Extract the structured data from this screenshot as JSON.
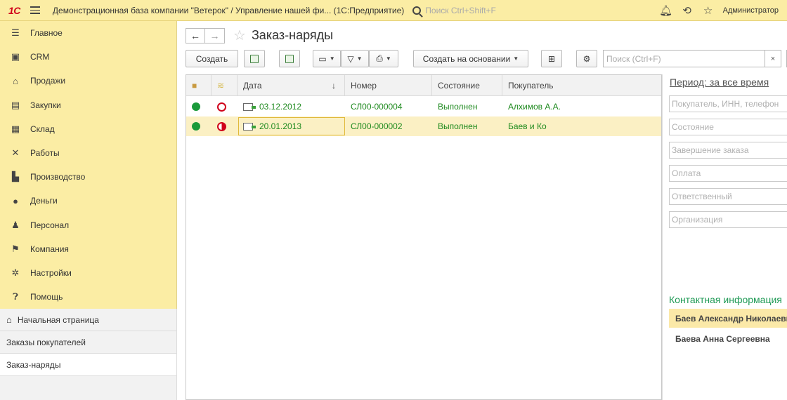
{
  "titlebar": {
    "logo": "1С",
    "title": "Демонстрационная база компании \"Ветерок\" / Управление нашей фи...   (1С:Предприятие)",
    "search_placeholder": "Поиск Ctrl+Shift+F",
    "user": "Администратор"
  },
  "sidebar": {
    "items": [
      {
        "label": "Главное",
        "icon": "menu-lines-icon"
      },
      {
        "label": "CRM",
        "icon": "contact-card-icon"
      },
      {
        "label": "Продажи",
        "icon": "shop-icon"
      },
      {
        "label": "Закупки",
        "icon": "cart-icon"
      },
      {
        "label": "Склад",
        "icon": "warehouse-icon"
      },
      {
        "label": "Работы",
        "icon": "tools-icon"
      },
      {
        "label": "Производство",
        "icon": "factory-icon"
      },
      {
        "label": "Деньги",
        "icon": "coin-icon"
      },
      {
        "label": "Персонал",
        "icon": "people-icon"
      },
      {
        "label": "Компания",
        "icon": "flag-icon"
      },
      {
        "label": "Настройки",
        "icon": "gear-icon"
      },
      {
        "label": "Помощь",
        "icon": "help-icon"
      }
    ]
  },
  "nav": {
    "home": "Начальная страница",
    "orders": "Заказы покупателей",
    "current": "Заказ-наряды"
  },
  "page": {
    "title": "Заказ-наряды"
  },
  "toolbar": {
    "create": "Создать",
    "create_based_on": "Создать на основании",
    "search_placeholder": "Поиск (Ctrl+F)",
    "clear": "×"
  },
  "table": {
    "headers": {
      "date": "Дата",
      "number": "Номер",
      "status": "Состояние",
      "buyer": "Покупатель",
      "sort_arrow": "↓"
    },
    "rows": [
      {
        "date": "03.12.2012",
        "number": "СЛ00-000004",
        "status": "Выполнен",
        "buyer": "Алхимов А.А."
      },
      {
        "date": "20.01.2013",
        "number": "СЛ00-000002",
        "status": "Выполнен",
        "buyer": "Баев и Ко"
      }
    ]
  },
  "filters": {
    "period": "Период: за все время",
    "buyer": "Покупатель, ИНН, телефон",
    "status": "Состояние",
    "completion": "Завершение заказа",
    "payment": "Оплата",
    "responsible": "Ответственный",
    "organization": "Организация"
  },
  "contacts": {
    "title": "Контактная информация",
    "items": [
      "Баев Александр Николаевич",
      "Баева Анна Сергеевна"
    ]
  },
  "colors": {
    "accent": "#fbeda4",
    "green": "#1f8a1f",
    "red": "#d0021b",
    "selection": "#fbf0c4"
  }
}
